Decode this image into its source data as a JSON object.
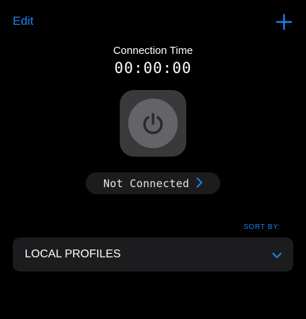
{
  "header": {
    "edit_label": "Edit",
    "add_icon": "plus-icon"
  },
  "connection": {
    "time_label": "Connection Time",
    "time_value": "00:00:00",
    "power_icon": "power-icon"
  },
  "status": {
    "text": "Not Connected",
    "chevron_icon": "chevron-right-icon"
  },
  "sort": {
    "label": "SORT BY:",
    "selected_option": "LOCAL PROFILES",
    "chevron_icon": "chevron-down-icon"
  },
  "colors": {
    "accent": "#1e82f0",
    "background": "#000000",
    "card": "#1c1c1e",
    "power_tile": "#39393c",
    "power_button": "#646467"
  }
}
